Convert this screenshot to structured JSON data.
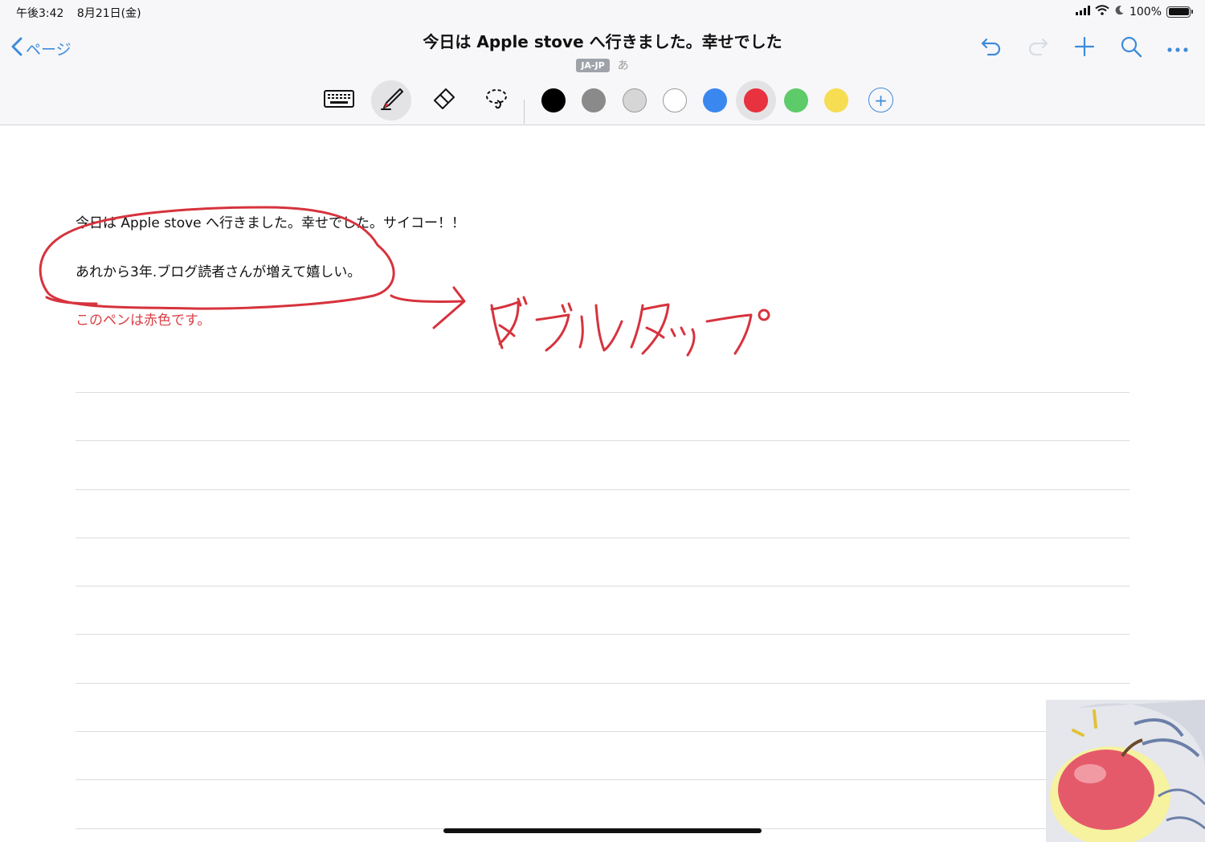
{
  "status_bar": {
    "time": "午後3:42",
    "date": "8月21日(金)",
    "battery": "100%",
    "battery_level": 1.0
  },
  "header": {
    "back_label": "ページ",
    "title": "今日は Apple stove へ行きました。幸せでした",
    "language_badge": "JA-JP",
    "input_mode": "あ",
    "actions": [
      "undo-icon",
      "redo-icon",
      "plus-icon",
      "search-icon",
      "more-icon"
    ]
  },
  "toolbar": {
    "tools": [
      {
        "name": "keyboard-icon",
        "selected": false
      },
      {
        "name": "pen-icon",
        "selected": true
      },
      {
        "name": "eraser-icon",
        "selected": false
      },
      {
        "name": "lasso-icon",
        "selected": false
      }
    ],
    "colors": [
      {
        "name": "black",
        "hex": "#000000",
        "selected": false
      },
      {
        "name": "gray",
        "hex": "#8a8a8a",
        "selected": false
      },
      {
        "name": "light-gray",
        "hex": "#d6d6d6",
        "selected": false
      },
      {
        "name": "white",
        "hex": "#ffffff",
        "selected": false
      },
      {
        "name": "blue",
        "hex": "#3a87f0",
        "selected": false
      },
      {
        "name": "red",
        "hex": "#e8323f",
        "selected": true
      },
      {
        "name": "green",
        "hex": "#5ecb6a",
        "selected": false
      },
      {
        "name": "yellow",
        "hex": "#f6dd52",
        "selected": false
      }
    ],
    "add_color_label": "+"
  },
  "note": {
    "lines": [
      {
        "text": "今日は Apple stove へ行きました。幸せでした。サイコー！！",
        "color": "#111111"
      },
      {
        "text": "あれから3年.ブログ読者さんが増えて嬉しい。",
        "color": "#111111"
      },
      {
        "text": "このペンは赤色です。",
        "color": "#d94046"
      }
    ],
    "handwritten_text": "ダブルタップ"
  },
  "accent_color": "#3d8bd9",
  "ink_color": "#d6333d"
}
